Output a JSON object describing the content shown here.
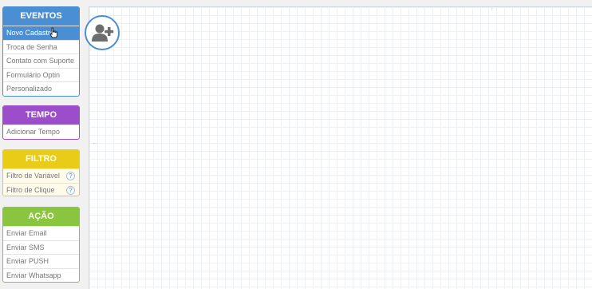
{
  "sidebar": {
    "eventos": {
      "title": "EVENTOS",
      "items": [
        {
          "label": "Novo Cadastro"
        },
        {
          "label": "Troca de Senha"
        },
        {
          "label": "Contato com Suporte"
        },
        {
          "label": "Formulário Optin"
        },
        {
          "label": "Personalizado"
        }
      ]
    },
    "tempo": {
      "title": "TEMPO",
      "items": [
        {
          "label": "Adicionar Tempo"
        }
      ]
    },
    "filtro": {
      "title": "FILTRO",
      "items": [
        {
          "label": "Filtro de Variável",
          "help": "?"
        },
        {
          "label": "Filtro de Clique",
          "help": "?"
        }
      ]
    },
    "acao": {
      "title": "AÇÃO",
      "items": [
        {
          "label": "Enviar Email"
        },
        {
          "label": "Enviar SMS"
        },
        {
          "label": "Enviar PUSH"
        },
        {
          "label": "Enviar Whatsapp"
        }
      ]
    }
  },
  "canvas": {
    "node_icon": "add-user-icon",
    "top_marker": "↑",
    "left_marker": "←"
  },
  "colors": {
    "eventos": "#4a8fd3",
    "tempo": "#9b4dca",
    "filtro": "#e8cc17",
    "acao": "#8ac53f"
  }
}
